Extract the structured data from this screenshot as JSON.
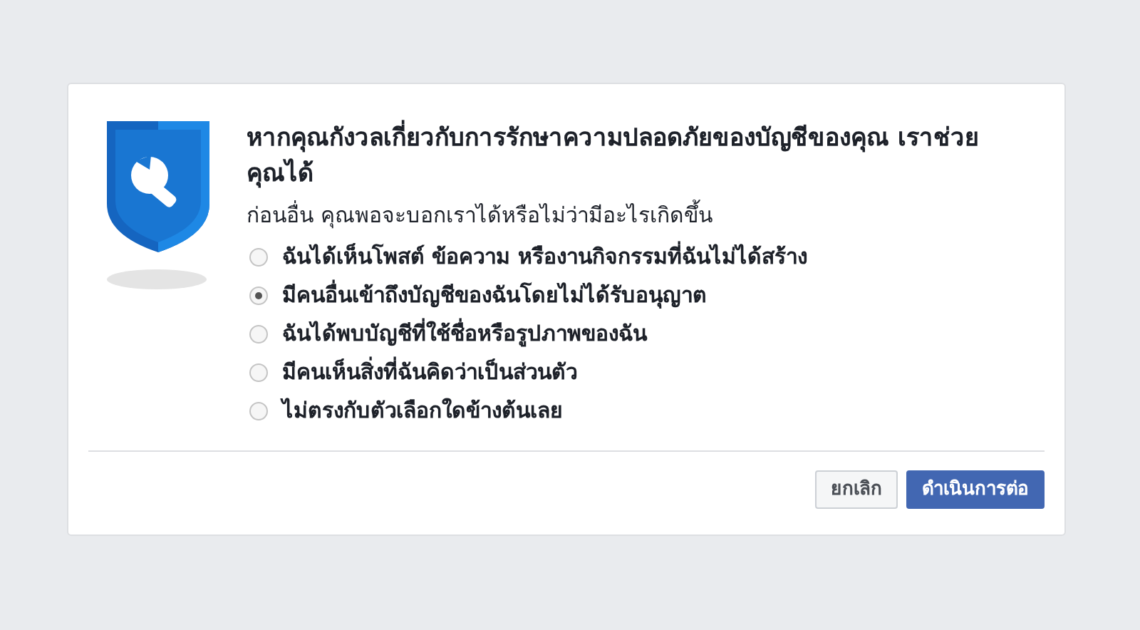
{
  "dialog": {
    "title": "หากคุณกังวลเกี่ยวกับการรักษาความปลอดภัยของบัญชีของคุณ เราช่วยคุณได้",
    "prompt": "ก่อนอื่น คุณพอจะบอกเราได้หรือไม่ว่ามีอะไรเกิดขึ้น",
    "options": [
      {
        "label": "ฉันได้เห็นโพสต์ ข้อความ หรืองานกิจกรรมที่ฉันไม่ได้สร้าง",
        "selected": false
      },
      {
        "label": "มีคนอื่นเข้าถึงบัญชีของฉันโดยไม่ได้รับอนุญาต",
        "selected": true
      },
      {
        "label": "ฉันได้พบบัญชีที่ใช้ชื่อหรือรูปภาพของฉัน",
        "selected": false
      },
      {
        "label": "มีคนเห็นสิ่งที่ฉันคิดว่าเป็นส่วนตัว",
        "selected": false
      },
      {
        "label": "ไม่ตรงกับตัวเลือกใดข้างต้นเลย",
        "selected": false
      }
    ],
    "buttons": [
      {
        "label": "ยกเลิก",
        "kind": "secondary"
      },
      {
        "label": "ดำเนินการต่อ",
        "kind": "primary"
      }
    ]
  }
}
